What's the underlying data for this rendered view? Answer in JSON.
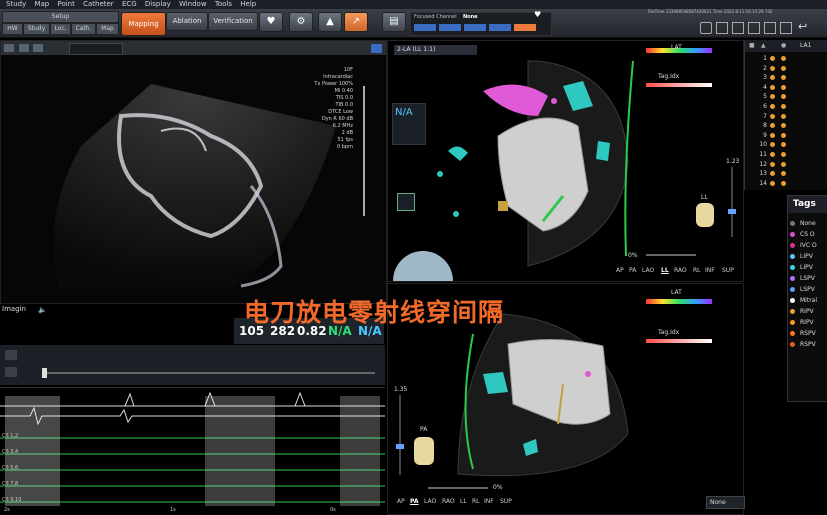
{
  "menu": [
    "Study",
    "Map",
    "Point",
    "Catheter",
    "ECG",
    "Display",
    "Window",
    "Tools",
    "Help"
  ],
  "toolbar": {
    "setup_label": "Setup",
    "setup_tabs": [
      "HW",
      "Study",
      "Loc.",
      "Cath.",
      "Map"
    ],
    "modes": [
      "Mapping",
      "Ablation",
      "Verification"
    ],
    "focused_channel_label": "Focused Channel",
    "focused_channel_value": "None",
    "status_line": "FileTime 133498508587420021 Time 2022 8:11:16:15:29 742"
  },
  "ultrasound": {
    "params": [
      "10F",
      "Intracardiac",
      "Tx Power 100%",
      "Mi 0.40",
      "TIS 0.0",
      "TIB 0.0",
      "DTCE Low",
      "Dyn R 60 dB",
      "6.2 MHz",
      "2 dB",
      "51 fps",
      "0 bpm"
    ],
    "imaging_label": "Imagin"
  },
  "metrics": [
    "105",
    "282",
    "0.82",
    "N/A",
    "N/A"
  ],
  "overlay_caption": "电刀放电零射线穿间隔",
  "ecg": {
    "channels": [
      "CS 1,2",
      "CS 3,4",
      "CS 5,6",
      "CS 7,8",
      "CS 9,10"
    ],
    "time_labels": [
      "2s",
      "1s",
      "0s"
    ]
  },
  "map_top": {
    "title": "2-LA (LL 1:1)",
    "lat_label": "LAT",
    "tagidx_label": "Tag.Idx",
    "na_label": "N/A",
    "zoom_value": "1.23",
    "zoom_pct": "0%",
    "orientation_label": "LL",
    "views": [
      "AP",
      "PA",
      "LAO",
      "LL",
      "RAO",
      "RL",
      "INF",
      "SUP"
    ],
    "active_view": "LL"
  },
  "map_bottom": {
    "lat_label": "LAT",
    "tagidx_label": "Tag.Idx",
    "zoom_value": "1.35",
    "zoom_pct": "0%",
    "orientation_label": "PA",
    "views": [
      "AP",
      "PA",
      "LAO",
      "RAO",
      "LL",
      "RL",
      "INF",
      "SUP"
    ],
    "active_view": "PA",
    "dropdown_value": "None"
  },
  "point_list": {
    "header": "LA1",
    "rows": [
      "1",
      "2",
      "3",
      "4",
      "5",
      "6",
      "7",
      "8",
      "9",
      "10",
      "11",
      "12",
      "13",
      "14"
    ]
  },
  "tags": {
    "title": "Tags",
    "items": [
      {
        "label": "None",
        "color": "#777777"
      },
      {
        "label": "CS O",
        "color": "#e04fd0"
      },
      {
        "label": "IVC O",
        "color": "#e0308f"
      },
      {
        "label": "LIPV",
        "color": "#58c8ff"
      },
      {
        "label": "LIPV",
        "color": "#3cd6e8"
      },
      {
        "label": "LSPV",
        "color": "#a874ff"
      },
      {
        "label": "LSPV",
        "color": "#5aa0ff"
      },
      {
        "label": "Mitral",
        "color": "#ffffff"
      },
      {
        "label": "RIPV",
        "color": "#f0a030"
      },
      {
        "label": "RIPV",
        "color": "#ff9a2a"
      },
      {
        "label": "RSPV",
        "color": "#ff7a20"
      },
      {
        "label": "RSPV",
        "color": "#e86018"
      }
    ]
  },
  "colors": {
    "accent": "#f07a3c",
    "ecg_green": "#2ec84a",
    "chamber": "#d8d8d8"
  }
}
